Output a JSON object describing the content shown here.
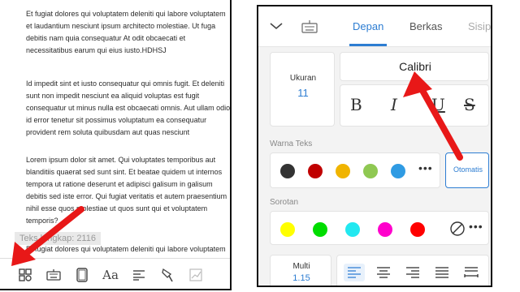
{
  "document": {
    "paragraph1": "Et fugiat dolores qui voluptatem deleniti qui labore voluptatem et laudantium nesciunt ipsum architecto molestiae. Ut fuga debitis nam quia consequatur At odit obcaecati et necessitatibus earum qui eius iusto.HDHSJ",
    "paragraph2": "Id impedit sint et iusto consequatur qui omnis fugit. Et deleniti sunt non impedit nesciunt ea aliquid voluptas est fugit consequatur ut minus nulla est obcaecati omnis. Aut ullam odio id error tenetur sit possimus voluptatum ea consequatur provident rem soluta quibusdam aut quas nesciunt",
    "paragraph3": "Lorem ipsum dolor sit amet. Qui voluptates temporibus aut blanditiis quaerat sed sunt sint. Et beatae quidem ut internos tempora ut ratione deserunt et adipisci galisum in galisum debitis sed iste error. Qui fugiat veritatis et autem praesentium nihil esse quos molestiae ut quos sunt qui et voluptatem temporis?",
    "paragraph4": "Et fugiat dolores qui voluptatem deleniti qui labore voluptatem",
    "word_count": "Teks lengkap: 2116"
  },
  "left_toolbar": {
    "icons": [
      "grid-icon",
      "keyboard-icon",
      "frame-icon",
      "font-size-icon",
      "align-icon",
      "format-paint-icon",
      "chart-icon"
    ],
    "font_size_glyph": "Aa"
  },
  "format_panel": {
    "tabs": [
      "Depan",
      "Berkas",
      "Sisip"
    ],
    "active_tab": "Depan",
    "size_label": "Ukuran",
    "size_value": "11",
    "font_name": "Calibri",
    "style_buttons": [
      "B",
      "I",
      "U",
      "S"
    ],
    "text_color_label": "Warna Teks",
    "text_colors": [
      "#333333",
      "#c00000",
      "#f0b400",
      "#8fc852",
      "#2f9be3"
    ],
    "auto_color_label": "Otomatis",
    "highlight_label": "Sorotan",
    "highlight_colors": [
      "#ffff00",
      "#00dd00",
      "#22e8f0",
      "#ff00cc",
      "#ff0000"
    ],
    "more_label": "•••",
    "spacing_label": "Multi",
    "spacing_value": "1.15",
    "active_alignment": "left"
  },
  "colors": {
    "accent": "#2d7dd2",
    "arrow": "#e81818"
  }
}
